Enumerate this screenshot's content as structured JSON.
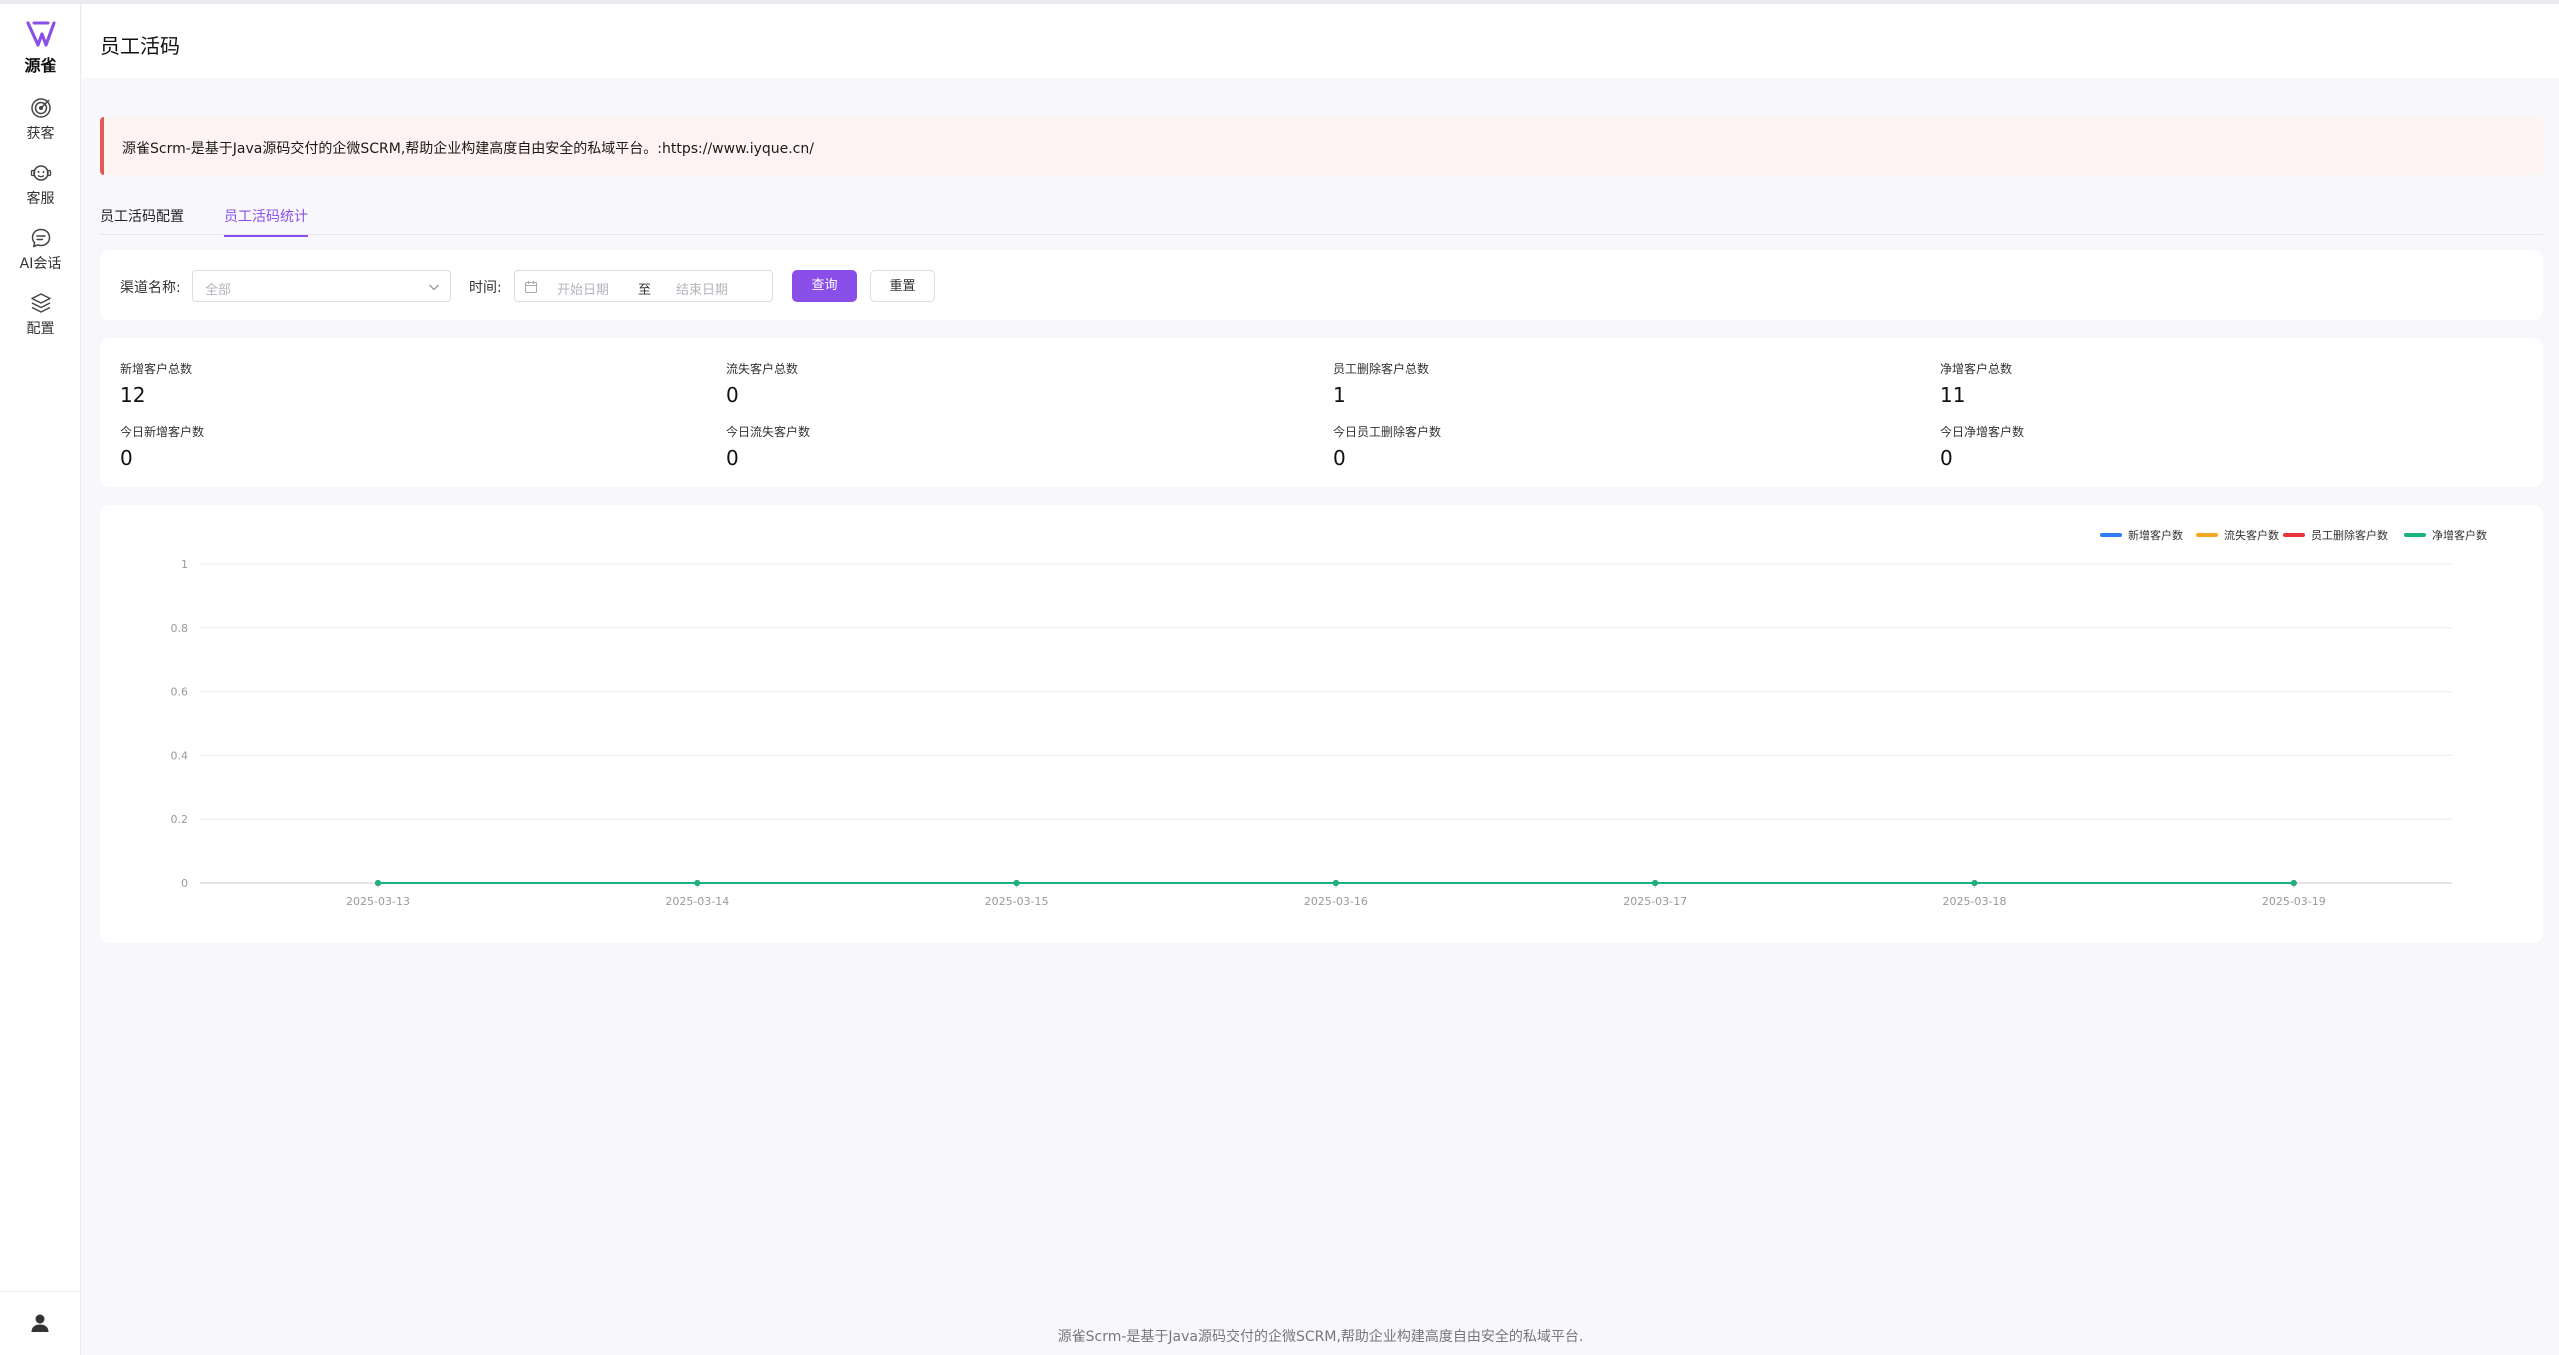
{
  "sidebar": {
    "logo_text": "源雀",
    "items": [
      {
        "label": "获客",
        "icon": "target-icon"
      },
      {
        "label": "客服",
        "icon": "customer-service-icon"
      },
      {
        "label": "AI会话",
        "icon": "chat-icon"
      },
      {
        "label": "配置",
        "icon": "layers-icon"
      }
    ],
    "user_icon": "user-icon"
  },
  "header": {
    "title": "员工活码"
  },
  "alert": {
    "text": "源雀Scrm-是基于Java源码交付的企微SCRM,帮助企业构建高度自由安全的私域平台。:https://www.iyque.cn/"
  },
  "tabs": [
    {
      "label": "员工活码配置",
      "active": false
    },
    {
      "label": "员工活码统计",
      "active": true
    }
  ],
  "filter": {
    "channel_label": "渠道名称:",
    "channel_value": "全部",
    "time_label": "时间:",
    "start_placeholder": "开始日期",
    "separator": "至",
    "end_placeholder": "结束日期",
    "query_button": "查询",
    "reset_button": "重置"
  },
  "stats": [
    {
      "label": "新增客户总数",
      "value": "12"
    },
    {
      "label": "流失客户总数",
      "value": "0"
    },
    {
      "label": "员工删除客户总数",
      "value": "1"
    },
    {
      "label": "净增客户总数",
      "value": "11"
    },
    {
      "label": "今日新增客户数",
      "value": "0"
    },
    {
      "label": "今日流失客户数",
      "value": "0"
    },
    {
      "label": "今日员工删除客户数",
      "value": "0"
    },
    {
      "label": "今日净增客户数",
      "value": "0"
    }
  ],
  "chart_data": {
    "type": "line",
    "title": "",
    "xlabel": "",
    "ylabel": "",
    "x": [
      "2025-03-13",
      "2025-03-14",
      "2025-03-15",
      "2025-03-16",
      "2025-03-17",
      "2025-03-18",
      "2025-03-19"
    ],
    "ylim": [
      0,
      1
    ],
    "yticks": [
      "0",
      "0.2",
      "0.4",
      "0.6",
      "0.8",
      "1"
    ],
    "grid": true,
    "legend_position": "top-right",
    "series": [
      {
        "name": "新增客户数",
        "color": "#2f7cf6",
        "values": [
          0,
          0,
          0,
          0,
          0,
          0,
          0
        ]
      },
      {
        "name": "流失客户数",
        "color": "#f5a623",
        "values": [
          0,
          0,
          0,
          0,
          0,
          0,
          0
        ]
      },
      {
        "name": "员工删除客户数",
        "color": "#e8363c",
        "values": [
          0,
          0,
          0,
          0,
          0,
          0,
          0
        ]
      },
      {
        "name": "净增客户数",
        "color": "#19b37f",
        "values": [
          0,
          0,
          0,
          0,
          0,
          0,
          0
        ]
      }
    ]
  },
  "footer": {
    "text": "源雀Scrm-是基于Java源码交付的企微SCRM,帮助企业构建高度自由安全的私域平台."
  },
  "colors": {
    "accent": "#8a4fe8",
    "alert_border": "#e05a5a",
    "alert_bg": "#fdf3f3"
  }
}
